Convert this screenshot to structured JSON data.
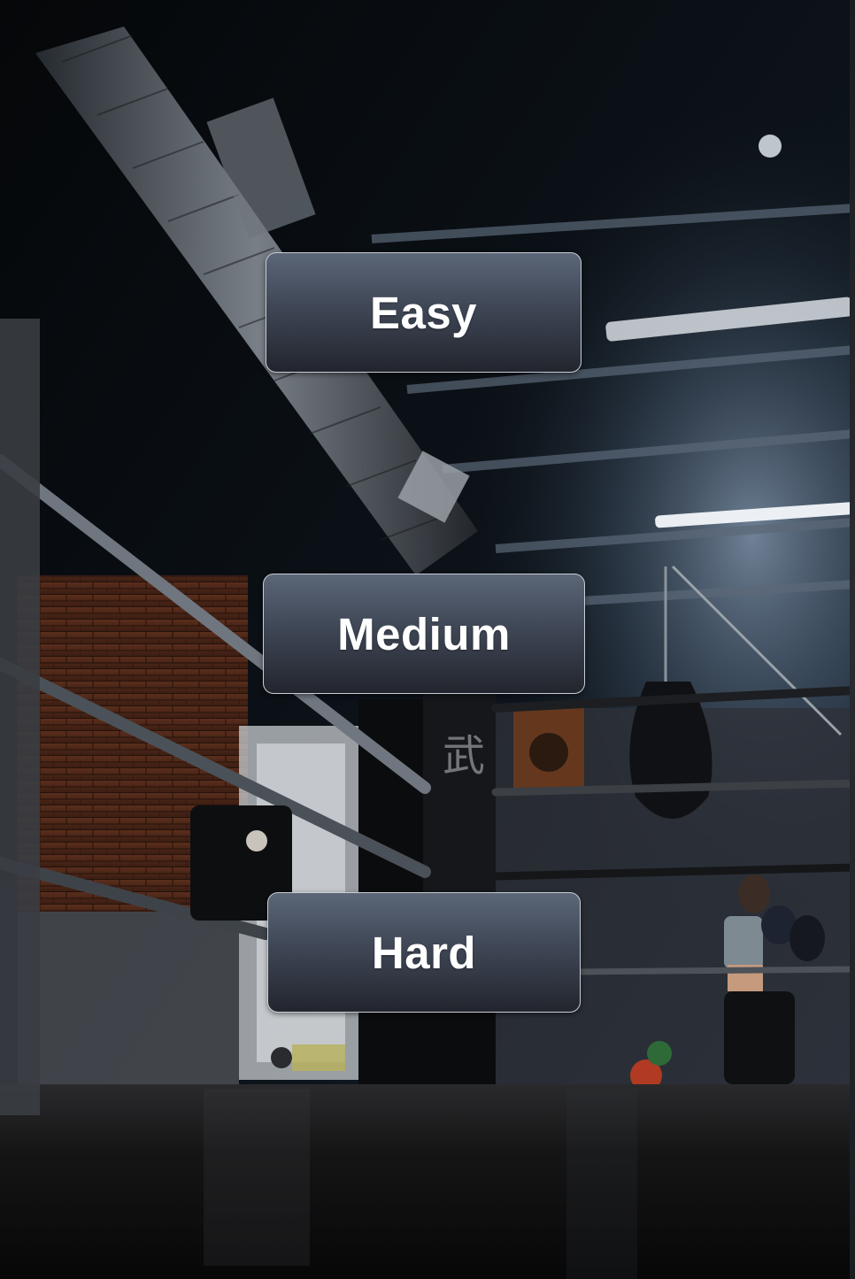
{
  "menu": {
    "buttons": [
      {
        "id": "easy",
        "label": "Easy"
      },
      {
        "id": "medium",
        "label": "Medium"
      },
      {
        "id": "hard",
        "label": "Hard"
      }
    ]
  },
  "theme": {
    "button_top": "#5b6677",
    "button_bottom": "#22252d",
    "button_border": "#c9ced6",
    "button_text": "#ffffff"
  }
}
